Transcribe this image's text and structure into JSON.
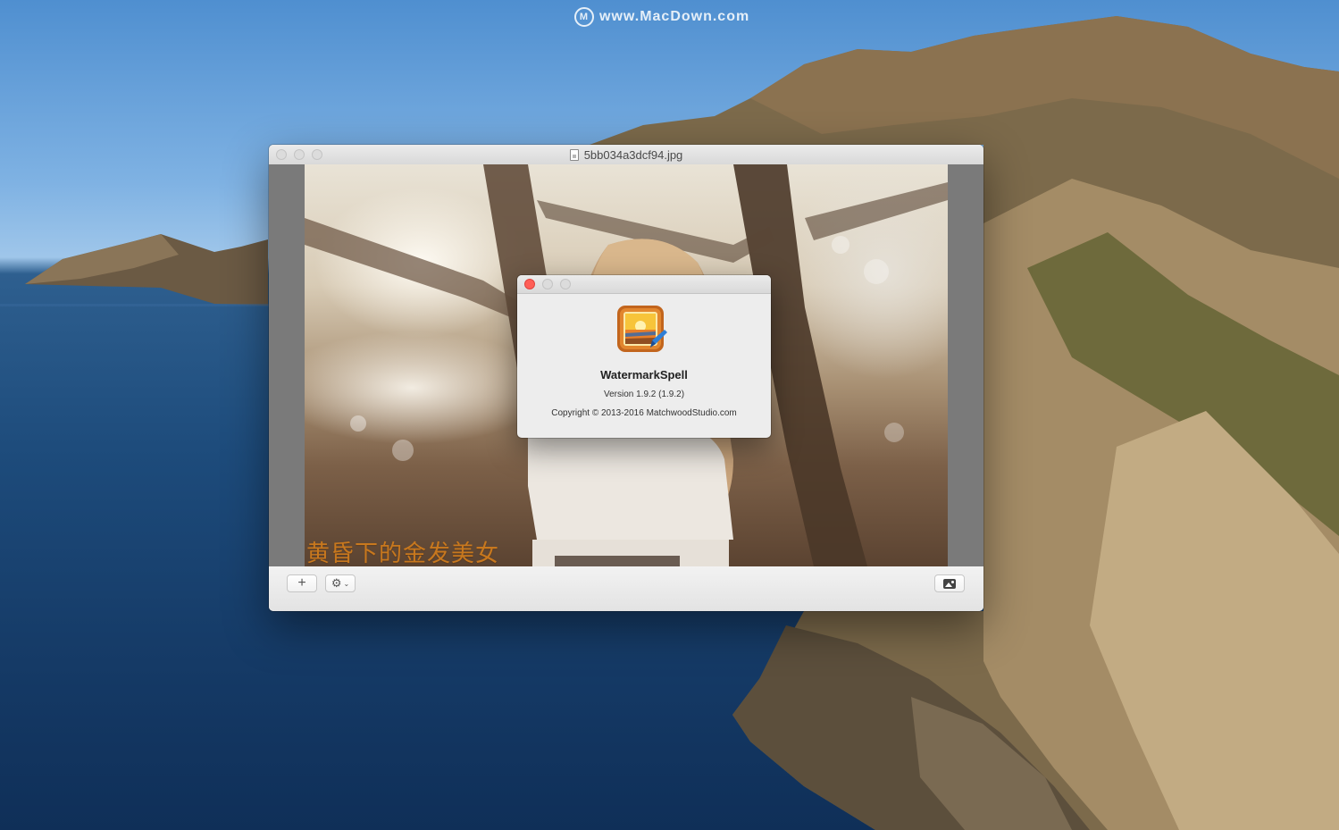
{
  "desktop": {
    "watermark_text": "www.MacDown.com",
    "watermark_icon": "M"
  },
  "main_window": {
    "title": "5bb034a3dcf94.jpg",
    "document_icon": "jpg-document-icon",
    "photo_caption": "黄昏下的金发美女",
    "caption_color": "#c8781e",
    "toolbar": {
      "add_label": "+",
      "gear_label": "⚙",
      "gear_chevron": "⌄",
      "photo_button_icon": "photo-icon"
    }
  },
  "about_dialog": {
    "app_name": "WatermarkSpell",
    "version": "Version 1.9.2 (1.9.2)",
    "copyright": "Copyright © 2013-2016 MatchwoodStudio.com",
    "close_color": "#ff5f57"
  }
}
